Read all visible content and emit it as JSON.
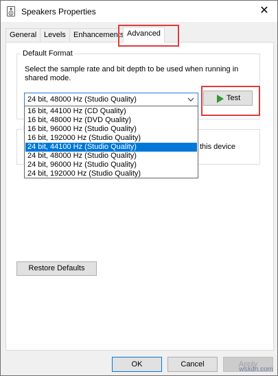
{
  "window": {
    "title": "Speakers Properties",
    "close_glyph": "✕"
  },
  "tabs": [
    {
      "label": "General",
      "active": false
    },
    {
      "label": "Levels",
      "active": false
    },
    {
      "label": "Enhancements",
      "active": false
    },
    {
      "label": "Advanced",
      "active": true
    }
  ],
  "default_format": {
    "group_title": "Default Format",
    "description": "Select the sample rate and bit depth to be used when running in shared mode.",
    "selected_value": "24 bit, 48000 Hz (Studio Quality)",
    "test_label": "Test",
    "options": [
      {
        "label": "16 bit, 44100 Hz (CD Quality)",
        "highlighted": false
      },
      {
        "label": "16 bit, 48000 Hz (DVD Quality)",
        "highlighted": false
      },
      {
        "label": "16 bit, 96000 Hz (Studio Quality)",
        "highlighted": false
      },
      {
        "label": "16 bit, 192000 Hz (Studio Quality)",
        "highlighted": false
      },
      {
        "label": "24 bit, 44100 Hz (Studio Quality)",
        "highlighted": true
      },
      {
        "label": "24 bit, 48000 Hz (Studio Quality)",
        "highlighted": false
      },
      {
        "label": "24 bit, 96000 Hz (Studio Quality)",
        "highlighted": false
      },
      {
        "label": "24 bit, 192000 Hz (Studio Quality)",
        "highlighted": false
      }
    ]
  },
  "exclusive_mode": {
    "group_title_fragment": "E",
    "text_fragment": "this device"
  },
  "restore_defaults_label": "Restore Defaults",
  "footer": {
    "ok_label": "OK",
    "cancel_label": "Cancel",
    "apply_label": "Apply"
  },
  "watermark": "wsxdn.com",
  "colors": {
    "selection": "#0078d7",
    "highlight_box": "#e03b3b",
    "test_icon": "#2f9a2f"
  }
}
